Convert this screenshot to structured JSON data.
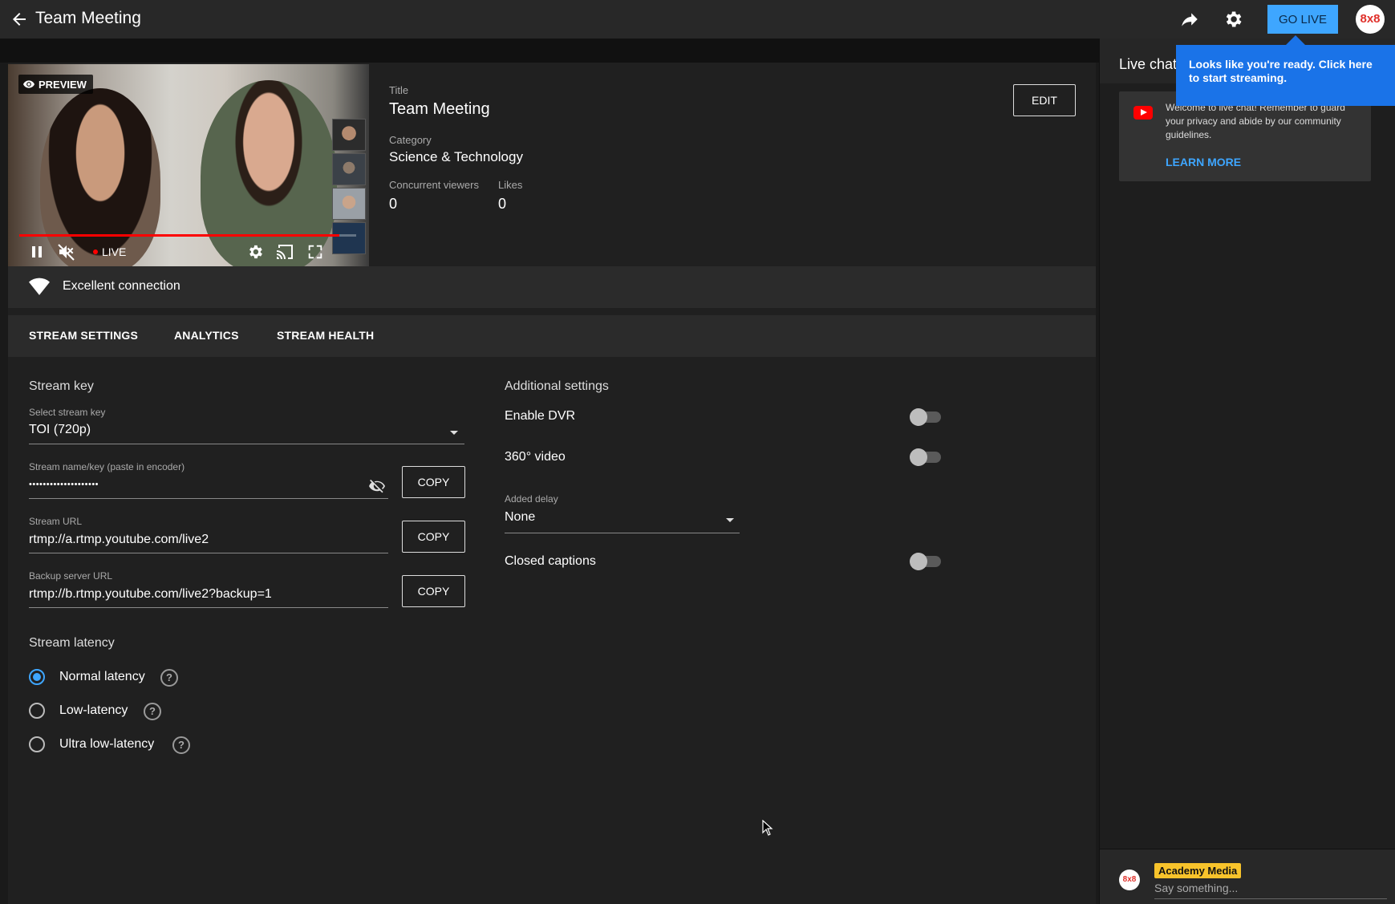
{
  "header": {
    "title": "Team Meeting",
    "go_live_label": "GO LIVE",
    "avatar_text": "8x8"
  },
  "preview": {
    "badge": "PREVIEW",
    "live_label": "LIVE",
    "progress_fraction": 0.95
  },
  "info": {
    "title_label": "Title",
    "title_value": "Team Meeting",
    "category_label": "Category",
    "category_value": "Science & Technology",
    "viewers_label": "Concurrent viewers",
    "viewers_value": "0",
    "likes_label": "Likes",
    "likes_value": "0",
    "edit_label": "EDIT"
  },
  "connection": {
    "status": "Excellent connection"
  },
  "tabs": [
    {
      "label": "STREAM SETTINGS"
    },
    {
      "label": "ANALYTICS"
    },
    {
      "label": "STREAM HEALTH"
    }
  ],
  "stream_key": {
    "section_title": "Stream key",
    "select_label": "Select stream key",
    "select_value": "TOI (720p)",
    "name_label": "Stream name/key (paste in encoder)",
    "name_value": "••••••••••••••••••••",
    "url_label": "Stream URL",
    "url_value": "rtmp://a.rtmp.youtube.com/live2",
    "backup_label": "Backup server URL",
    "backup_value": "rtmp://b.rtmp.youtube.com/live2?backup=1",
    "copy_label": "COPY"
  },
  "latency": {
    "section_title": "Stream latency",
    "options": [
      {
        "label": "Normal latency",
        "checked": true
      },
      {
        "label": "Low-latency",
        "checked": false
      },
      {
        "label": "Ultra low-latency",
        "checked": false
      }
    ],
    "help_glyph": "?"
  },
  "additional": {
    "section_title": "Additional settings",
    "dvr_label": "Enable DVR",
    "video360_label": "360° video",
    "delay_label": "Added delay",
    "delay_value": "None",
    "captions_label": "Closed captions"
  },
  "chat": {
    "title": "Live chat",
    "tooltip": "Looks like you're ready. Click here to start streaming.",
    "welcome": "Welcome to live chat! Remember to guard your privacy and abide by our community guidelines.",
    "learn_more": "LEARN MORE",
    "avatar_text": "8x8",
    "channel_name": "Academy Media",
    "input_placeholder": "Say something..."
  },
  "colors": {
    "accent": "#3ea6ff",
    "tooltip": "#1a73e8",
    "live_red": "#ff0000",
    "badge_yellow": "#f8c32b"
  }
}
